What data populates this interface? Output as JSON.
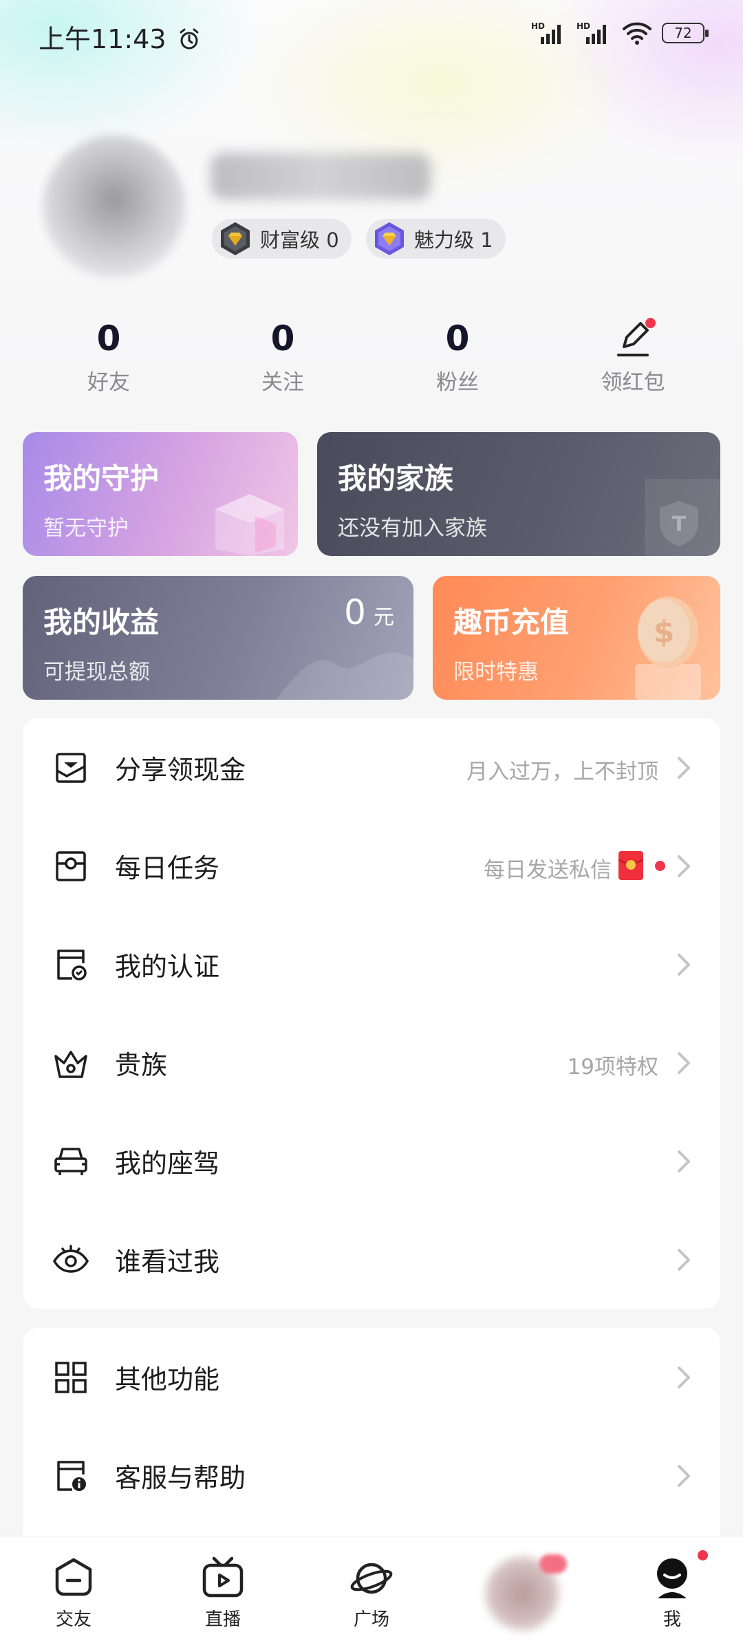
{
  "status_bar": {
    "time": "上午11:43",
    "battery": "72"
  },
  "profile": {
    "levels": [
      {
        "label": "财富级 0"
      },
      {
        "label": "魅力级 1"
      }
    ]
  },
  "stats": [
    {
      "value": "0",
      "label": "好友"
    },
    {
      "value": "0",
      "label": "关注"
    },
    {
      "value": "0",
      "label": "粉丝"
    }
  ],
  "red_packet": {
    "label": "领红包"
  },
  "cards": {
    "guard": {
      "title": "我的守护",
      "subtitle": "暂无守护"
    },
    "family": {
      "title": "我的家族",
      "subtitle": "还没有加入家族"
    },
    "earnings": {
      "title": "我的收益",
      "subtitle": "可提现总额",
      "amount": "0",
      "unit": "元"
    },
    "recharge": {
      "title": "趣币充值",
      "subtitle": "限时特惠"
    }
  },
  "menu_main": [
    {
      "label": "分享领现金",
      "hint": "月入过万，上不封顶",
      "icon": "share-envelope-icon"
    },
    {
      "label": "每日任务",
      "hint": "每日发送私信",
      "icon": "task-icon"
    },
    {
      "label": "我的认证",
      "hint": "",
      "icon": "certificate-icon"
    },
    {
      "label": "贵族",
      "hint": "19项特权",
      "icon": "crown-icon"
    },
    {
      "label": "我的座驾",
      "hint": "",
      "icon": "car-icon"
    },
    {
      "label": "谁看过我",
      "hint": "",
      "icon": "eye-icon"
    }
  ],
  "menu_other": [
    {
      "label": "其他功能",
      "icon": "grid-icon"
    },
    {
      "label": "客服与帮助",
      "icon": "help-icon"
    }
  ],
  "nav": [
    {
      "label": "交友",
      "icon": "chat-icon"
    },
    {
      "label": "直播",
      "icon": "tv-play-icon"
    },
    {
      "label": "广场",
      "icon": "planet-icon"
    },
    {
      "label": "我",
      "icon": "profile-icon"
    }
  ],
  "colors": {
    "accent_red": "#f0364f",
    "text_primary": "#1d1d1f",
    "text_hint": "#a7a7ab"
  }
}
